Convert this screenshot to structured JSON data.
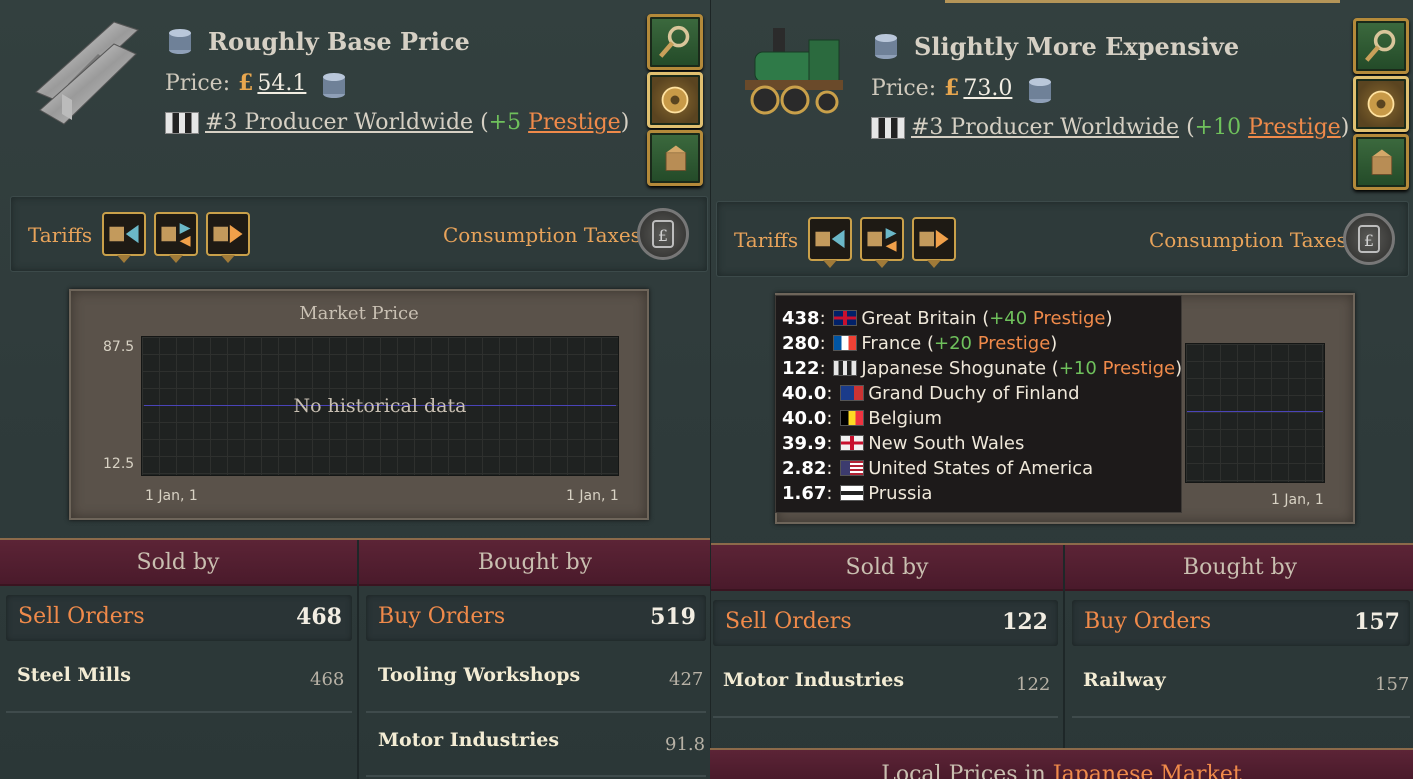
{
  "left": {
    "price_status": "Roughly Base Price",
    "price_label": "Price:",
    "currency": "£",
    "price_value": "54.1",
    "rank_text": "#3 Producer Worldwide",
    "rank_bonus_open": "(",
    "rank_bonus_value": "+5",
    "rank_bonus_word": "Prestige",
    "rank_bonus_close": ")",
    "tariffs_label": "Tariffs",
    "consumption_label": "Consumption Taxes",
    "chart_title": "Market Price",
    "no_data": "No historical data",
    "sold_by": "Sold by",
    "bought_by": "Bought by",
    "sell_orders_label": "Sell Orders",
    "sell_orders_value": "468",
    "buy_orders_label": "Buy Orders",
    "buy_orders_value": "519",
    "sellers": [
      {
        "name": "Steel Mills",
        "value": "468"
      }
    ],
    "buyers": [
      {
        "name": "Tooling Workshops",
        "value": "427"
      },
      {
        "name": "Motor Industries",
        "value": "91.8"
      }
    ]
  },
  "right": {
    "price_status": "Slightly More Expensive",
    "price_label": "Price:",
    "currency": "£",
    "price_value": "73.0",
    "rank_text": "#3 Producer Worldwide",
    "rank_bonus_open": "(",
    "rank_bonus_value": "+10",
    "rank_bonus_word": "Prestige",
    "rank_bonus_close": ")",
    "tariffs_label": "Tariffs",
    "consumption_label": "Consumption Taxes",
    "sold_by": "Sold by",
    "bought_by": "Bought by",
    "sell_orders_label": "Sell Orders",
    "sell_orders_value": "122",
    "buy_orders_label": "Buy Orders",
    "buy_orders_value": "157",
    "sellers": [
      {
        "name": "Motor Industries",
        "value": "122"
      }
    ],
    "buyers": [
      {
        "name": "Railway",
        "value": "157"
      }
    ],
    "local_prices_prefix": "Local Prices in",
    "local_prices_market": "Japanese Market"
  },
  "tooltip": {
    "rows": [
      {
        "value": "438",
        "country": "Great Britain",
        "bonus": "+40",
        "prestige": "Prestige"
      },
      {
        "value": "280",
        "country": "France",
        "bonus": "+20",
        "prestige": "Prestige"
      },
      {
        "value": "122",
        "country": "Japanese Shogunate",
        "bonus": "+10",
        "prestige": "Prestige"
      },
      {
        "value": "40.0",
        "country": "Grand Duchy of Finland"
      },
      {
        "value": "40.0",
        "country": "Belgium"
      },
      {
        "value": "39.9",
        "country": "New South Wales"
      },
      {
        "value": "2.82",
        "country": "United States of America"
      },
      {
        "value": "1.67",
        "country": "Prussia"
      }
    ]
  },
  "chart_data": [
    {
      "type": "line",
      "title": "Market Price",
      "ylim": [
        12.5,
        87.5
      ],
      "yticks": [
        "87.5",
        "12.5"
      ],
      "xticks": [
        "1 Jan, 1",
        "1 Jan, 1"
      ],
      "series": [],
      "annotation": "No historical data"
    },
    {
      "type": "line",
      "xticks": [
        "1 Jan, 1"
      ],
      "series": []
    }
  ],
  "colors": {
    "accent": "#f08a4a",
    "positive": "#6fc15c",
    "band": "#5c2436",
    "chart_line": "#4a44b8"
  }
}
